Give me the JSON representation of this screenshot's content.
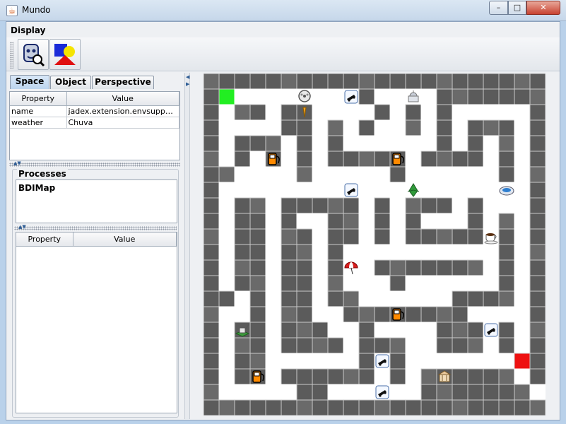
{
  "window": {
    "title": "Mundo",
    "app_icon": "java-cup-icon"
  },
  "caption_buttons": {
    "minimize": "–",
    "maximize": "□",
    "close": "✕"
  },
  "toolbar": {
    "label": "Display",
    "buttons": [
      {
        "name": "observer-button",
        "icon": "observer-agent-icon"
      },
      {
        "name": "perspective-button",
        "icon": "shapes-icon"
      }
    ]
  },
  "tabs": [
    {
      "label": "Space",
      "active": true
    },
    {
      "label": "Object",
      "active": false
    },
    {
      "label": "Perspective",
      "active": false
    }
  ],
  "space_table": {
    "columns": [
      "Property",
      "Value"
    ],
    "rows": [
      {
        "property": "name",
        "value": "jadex.extension.envsuppor..."
      },
      {
        "property": "weather",
        "value": "Chuva"
      }
    ]
  },
  "processes": {
    "title": "Processes",
    "items": [
      "BDIMap"
    ],
    "table_columns": [
      "Property",
      "Value"
    ]
  },
  "map": {
    "cols": 22,
    "rows": 22,
    "walkable_color": "#ffffff",
    "wall_color": "#5b5b5b",
    "start_color": "#22ee22",
    "goal_color": "#ee1111",
    "start": [
      1,
      1
    ],
    "goal": [
      20,
      18
    ],
    "walkable": [
      "......................",
      ".#########.####.......",
      ".#..#..####.#.#.#####.",
      ".####..#.#.##.#.#...#.",
      ".#...#.#.######.#.#.#.",
      ".#.#.#.#.....#....#.#.",
      "..####.#####.######.#.",
      ".####################.",
      ".#..#.....#.#...#.###.",
      ".#..#.##..#.#.###.#.#.",
      ".#..#..#..#.#.....#.#.",
      ".#..#..#.##########.#.",
      ".#..#..#.##.......#.#.",
      ".#..#..#.###.######.#.",
      "..#.#..#..######....#.",
      ".##.#..##........####.",
      ".#..#...##.####...#.#.",
      ".#..#....#...##...#.#.",
      ".#..######.#.#######@.",
      ".#..#......#.#......#.",
      ".#####..######.......#",
      "......................"
    ],
    "items": [
      {
        "icon": "film-reel-icon",
        "col": 6,
        "row": 1
      },
      {
        "icon": "carrot-icon",
        "col": 6,
        "row": 2
      },
      {
        "icon": "truck-icon",
        "col": 9,
        "row": 1
      },
      {
        "icon": "bank-dome-icon",
        "col": 13,
        "row": 1
      },
      {
        "icon": "gas-pump-icon",
        "col": 4,
        "row": 5
      },
      {
        "icon": "gas-pump-icon",
        "col": 12,
        "row": 5
      },
      {
        "icon": "truck-icon",
        "col": 9,
        "row": 7
      },
      {
        "icon": "leaf-icon",
        "col": 13,
        "row": 7
      },
      {
        "icon": "stadium-icon",
        "col": 19,
        "row": 7
      },
      {
        "icon": "coffee-cup-icon",
        "col": 18,
        "row": 10
      },
      {
        "icon": "umbrella-icon",
        "col": 9,
        "row": 12
      },
      {
        "icon": "gas-pump-icon",
        "col": 12,
        "row": 15
      },
      {
        "icon": "truck-icon",
        "col": 18,
        "row": 16
      },
      {
        "icon": "farm-icon",
        "col": 2,
        "row": 16
      },
      {
        "icon": "truck-icon",
        "col": 11,
        "row": 18
      },
      {
        "icon": "gas-pump-icon",
        "col": 3,
        "row": 19
      },
      {
        "icon": "museum-icon",
        "col": 15,
        "row": 19
      },
      {
        "icon": "truck-icon",
        "col": 11,
        "row": 20
      }
    ]
  }
}
